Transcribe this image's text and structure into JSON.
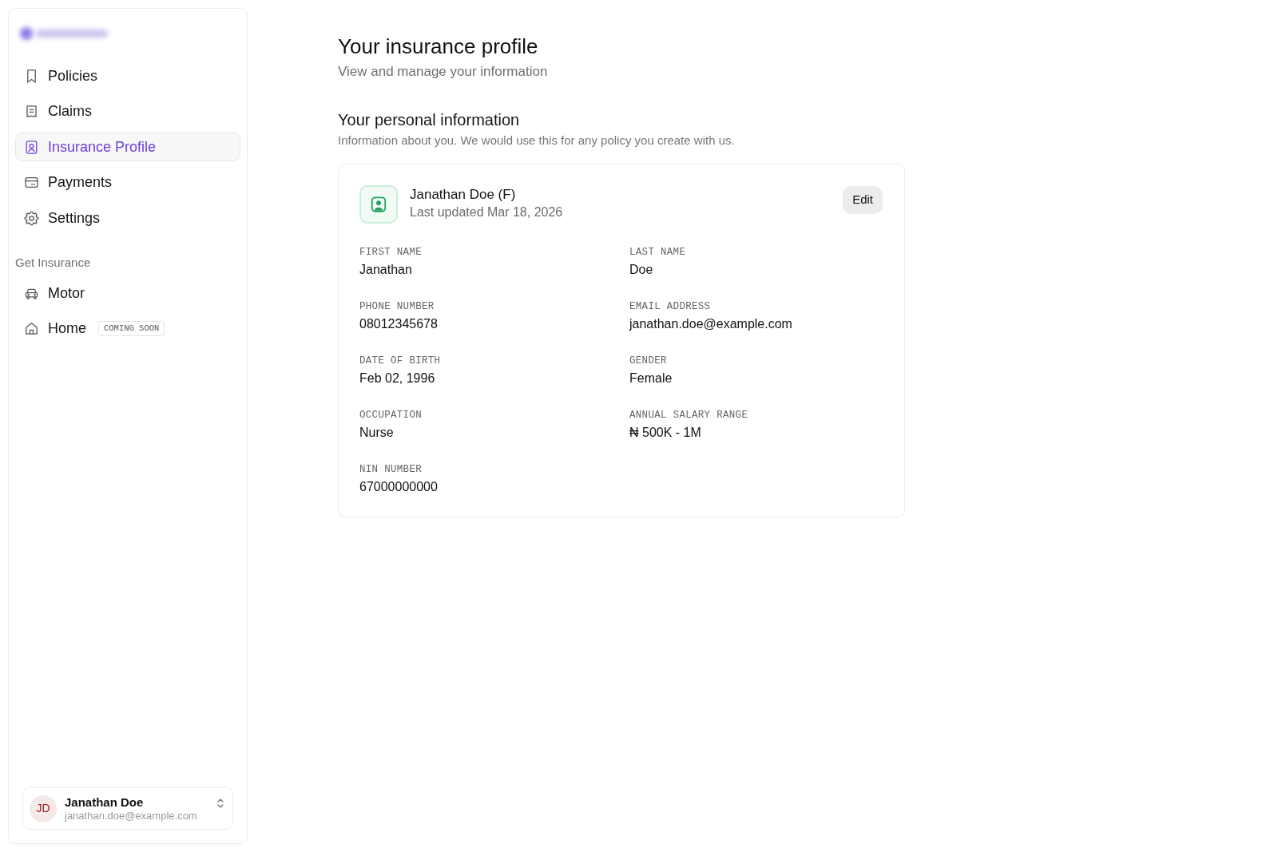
{
  "sidebar": {
    "nav_items": [
      {
        "label": "Policies",
        "selected": false
      },
      {
        "label": "Claims",
        "selected": false
      },
      {
        "label": "Insurance Profile",
        "selected": true
      },
      {
        "label": "Payments",
        "selected": false
      },
      {
        "label": "Settings",
        "selected": false
      }
    ],
    "section": {
      "title": "Get Insurance",
      "items": [
        {
          "label": "Motor",
          "selected": false
        },
        {
          "label": "Home",
          "selected": false,
          "badge": "COMING SOON"
        }
      ]
    },
    "user": {
      "initials": "JD",
      "name": "Janathan Doe",
      "email": "janathan.doe@example.com"
    }
  },
  "page_header": {
    "title": "Your insurance profile",
    "subtitle": "View and manage your information"
  },
  "personal_info": {
    "title": "Your personal information",
    "description": "Information about you. We would use this for any policy you create with us.",
    "card": {
      "name": "Janathan Doe (F)",
      "last_updated": "Last updated Mar 18, 2026",
      "edit_button": "Edit",
      "fields": [
        {
          "label": "FIRST NAME",
          "value": "Janathan"
        },
        {
          "label": "LAST NAME",
          "value": "Doe"
        },
        {
          "label": "PHONE NUMBER",
          "value": "08012345678"
        },
        {
          "label": "EMAIL ADDRESS",
          "value": "janathan.doe@example.com"
        },
        {
          "label": "DATE OF BIRTH",
          "value": "Feb 02, 1996"
        },
        {
          "label": "GENDER",
          "value": "Female"
        },
        {
          "label": "OCCUPATION",
          "value": "Nurse"
        },
        {
          "label": "ANNUAL SALARY RANGE",
          "value": "₦ 500K - 1M"
        },
        {
          "label": "NIN NUMBER",
          "value": "67000000000"
        }
      ]
    }
  }
}
